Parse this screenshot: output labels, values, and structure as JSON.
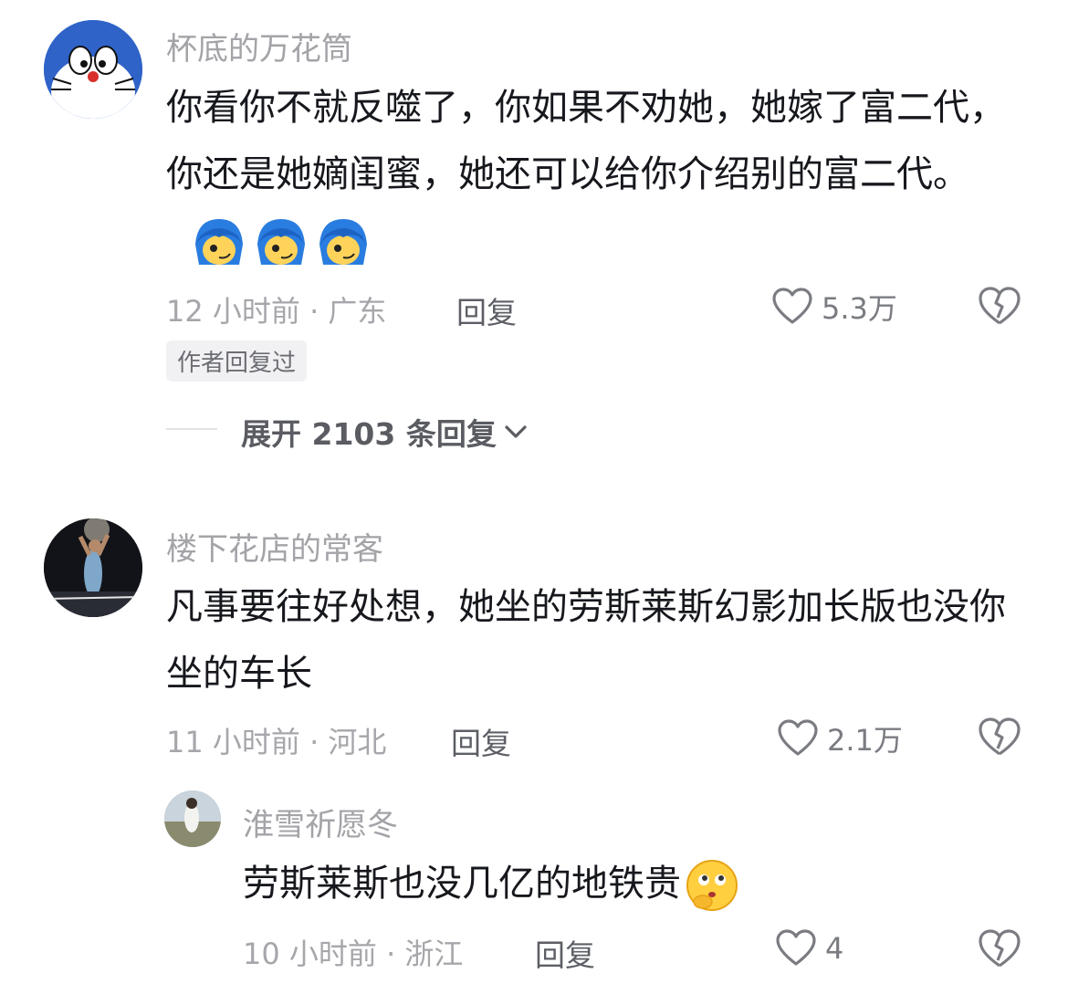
{
  "comments": [
    {
      "username": "杯底的万花筒",
      "avatar_icon": "doraemon-avatar",
      "text": "你看你不就反噬了，你如果不劝她，她嫁了富二代，你还是她嫡闺蜜，她还可以给你介绍别的富二代。",
      "emoji_icon": "blue-hair-smirk-emoji",
      "time": "12 小时前",
      "location": "广东",
      "reply_label": "回复",
      "likes": "5.3万",
      "badge": "作者回复过",
      "expand_label": "展开 2103 条回复"
    },
    {
      "username": "楼下花店的常客",
      "avatar_icon": "basketball-player-avatar",
      "text": "凡事要往好处想，她坐的劳斯莱斯幻影加长版也没你坐的车长",
      "time": "11 小时前",
      "location": "河北",
      "reply_label": "回复",
      "likes": "2.1万"
    }
  ],
  "replies": [
    {
      "username": "淮雪祈愿冬",
      "avatar_icon": "photo-avatar",
      "text": "劳斯莱斯也没几亿的地铁贵",
      "emoji_icon": "thinking-face-emoji",
      "time": "10 小时前",
      "location": "浙江",
      "reply_label": "回复",
      "likes": "4"
    }
  ],
  "separator": "·",
  "colors": {
    "background": "#ffffff",
    "text": "#16181d",
    "muted": "#a6a6ab"
  }
}
